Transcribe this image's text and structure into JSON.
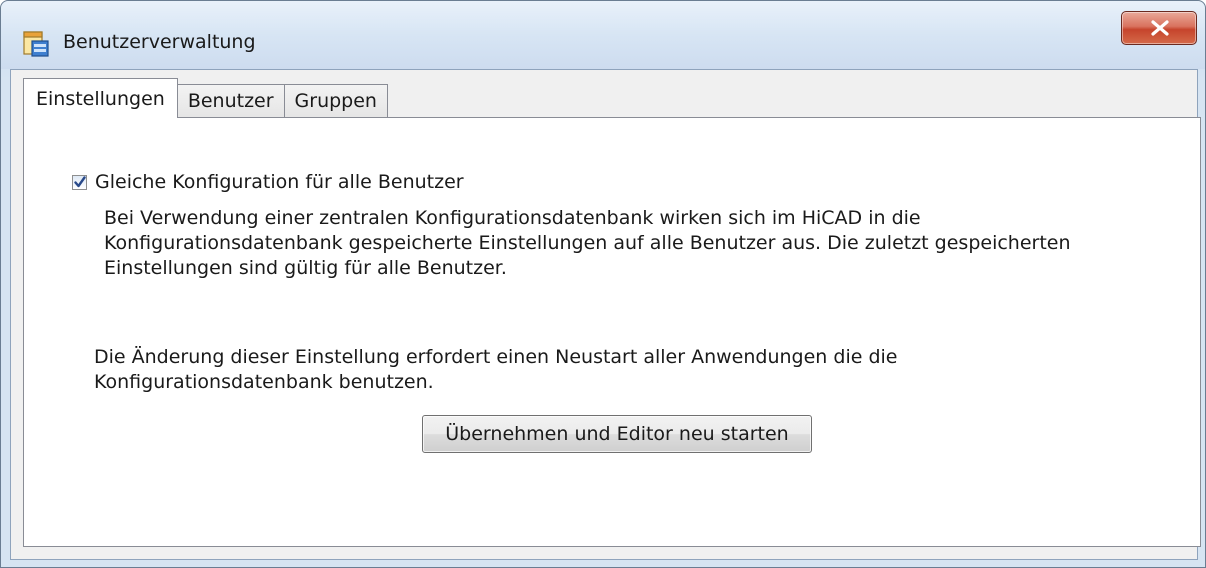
{
  "window": {
    "title": "Benutzerverwaltung",
    "icon": "app-window-icon",
    "close_icon": "close-icon"
  },
  "tabs": [
    {
      "label": "Einstellungen",
      "active": true
    },
    {
      "label": "Benutzer",
      "active": false
    },
    {
      "label": "Gruppen",
      "active": false
    }
  ],
  "settings": {
    "checkbox_label": "Gleiche Konfiguration für alle Benutzer",
    "checkbox_checked": true,
    "description": [
      "Bei Verwendung einer zentralen Konfigurationsdatenbank wirken sich im HiCAD in die",
      "Konfigurationsdatenbank gespeicherte Einstellungen auf alle Benutzer aus. Die zuletzt gespeicherten",
      "Einstellungen sind gültig für alle Benutzer."
    ],
    "note": [
      "Die Änderung dieser Einstellung erfordert einen Neustart aller Anwendungen die die",
      "Konfigurationsdatenbank benutzen."
    ],
    "apply_button_label": "Übernehmen und Editor neu starten"
  },
  "colors": {
    "close_button": "#c6442c",
    "checkmark": "#2a4a8a",
    "panel_border": "#898c95"
  }
}
